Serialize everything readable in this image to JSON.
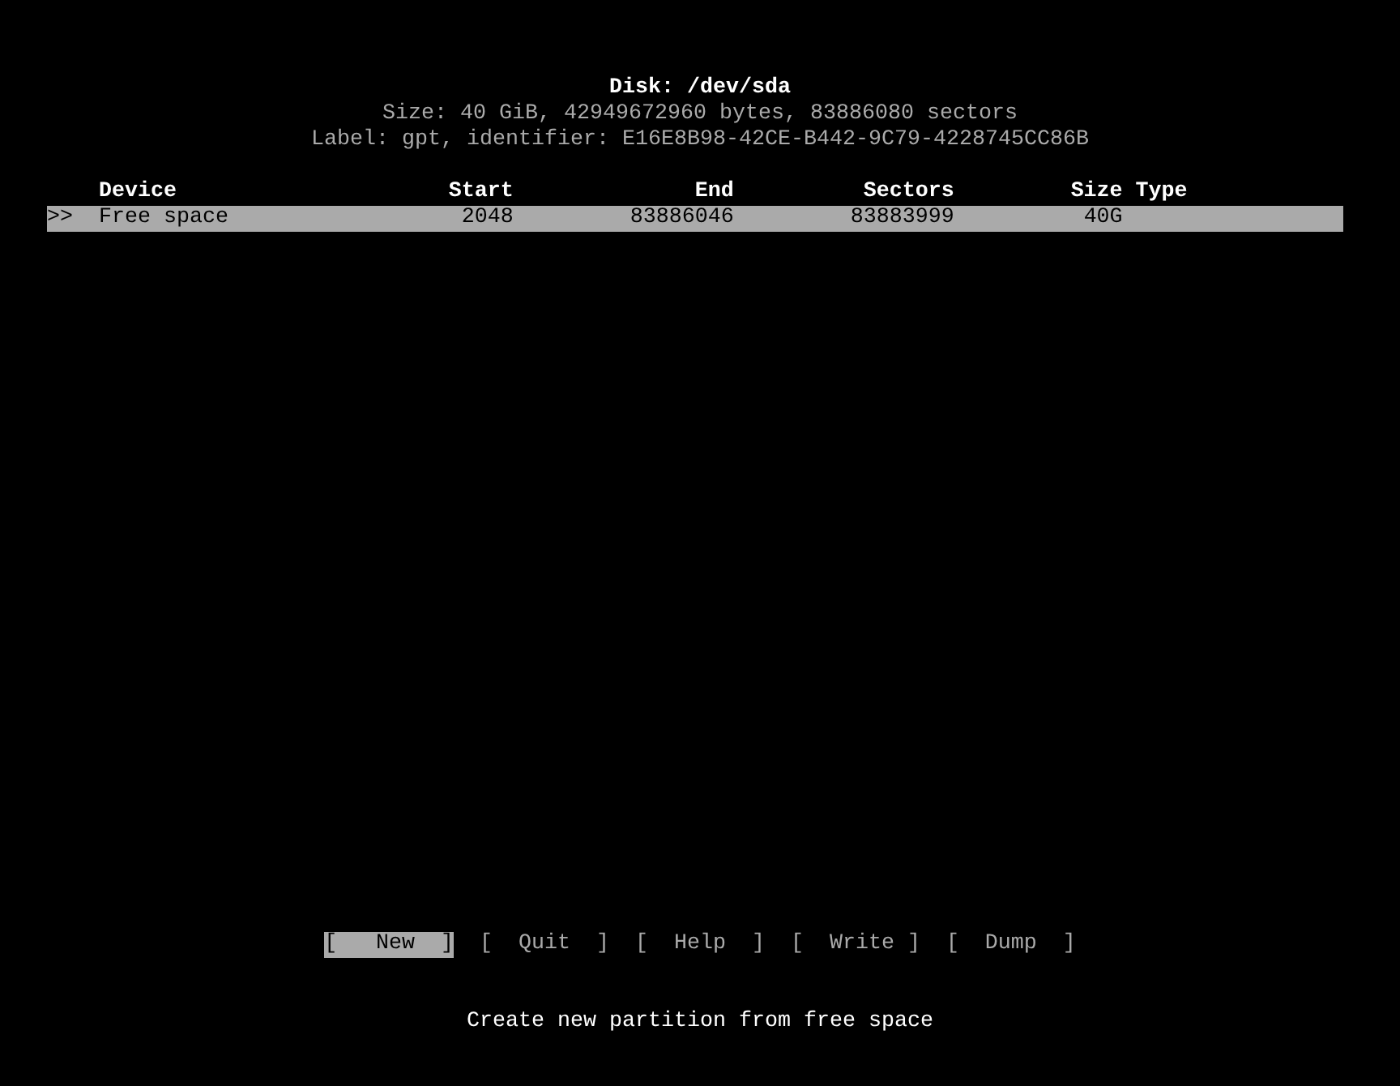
{
  "header": {
    "title": "Disk: /dev/sda",
    "size_line": "Size: 40 GiB, 42949672960 bytes, 83886080 sectors",
    "label_line": "Label: gpt, identifier: E16E8B98-42CE-B442-9C79-4228745CC86B"
  },
  "table": {
    "columns": [
      "Device",
      "Start",
      "End",
      "Sectors",
      "Size",
      "Type"
    ],
    "rows": [
      {
        "marker": ">>",
        "device": "Free space",
        "start": "2048",
        "end": "83886046",
        "sectors": "83883999",
        "size": "40G",
        "selected": true
      }
    ]
  },
  "buttons": [
    {
      "label": "[   New  ]",
      "selected": true
    },
    {
      "label": "[  Quit  ]",
      "selected": false
    },
    {
      "label": "[  Help  ]",
      "selected": false
    },
    {
      "label": "[  Write ]",
      "selected": false
    },
    {
      "label": "[  Dump  ]",
      "selected": false
    }
  ],
  "hint": "Create new partition from free space"
}
